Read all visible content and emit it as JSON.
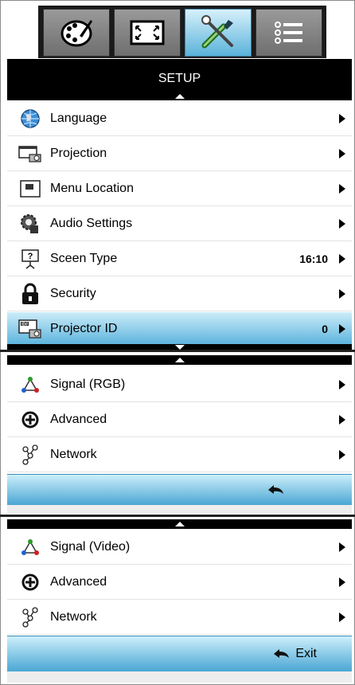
{
  "tabs": [
    {
      "name": "image-settings",
      "icon": "palette-icon",
      "active": false
    },
    {
      "name": "display",
      "icon": "fullscreen-icon",
      "active": false
    },
    {
      "name": "setup",
      "icon": "tools-icon",
      "active": true
    },
    {
      "name": "options",
      "icon": "list-icon",
      "active": false
    }
  ],
  "header": {
    "title": "SETUP"
  },
  "setup_items": [
    {
      "label": "Language",
      "icon": "globe-icon",
      "value": ""
    },
    {
      "label": "Projection",
      "icon": "projector-icon",
      "value": ""
    },
    {
      "label": "Menu Location",
      "icon": "menu-location-icon",
      "value": ""
    },
    {
      "label": "Audio Settings",
      "icon": "audio-settings-icon",
      "value": ""
    },
    {
      "label": "Sceen Type",
      "icon": "screen-type-icon",
      "value": "16:10"
    },
    {
      "label": "Security",
      "icon": "lock-icon",
      "value": ""
    },
    {
      "label": "Projector ID",
      "icon": "projector-id-icon",
      "value": "0",
      "selected": true
    }
  ],
  "rgb_items": [
    {
      "label": "Signal (RGB)",
      "icon": "signal-icon"
    },
    {
      "label": "Advanced",
      "icon": "advanced-icon"
    },
    {
      "label": "Network",
      "icon": "network-icon"
    }
  ],
  "video_items": [
    {
      "label": "Signal (Video)",
      "icon": "signal-icon"
    },
    {
      "label": "Advanced",
      "icon": "advanced-icon"
    },
    {
      "label": "Network",
      "icon": "network-icon"
    }
  ],
  "footer": {
    "exit_label": "Exit"
  },
  "colors": {
    "highlight": "#58b2dc",
    "header": "#000000",
    "tab_active": "#5bb3da"
  }
}
